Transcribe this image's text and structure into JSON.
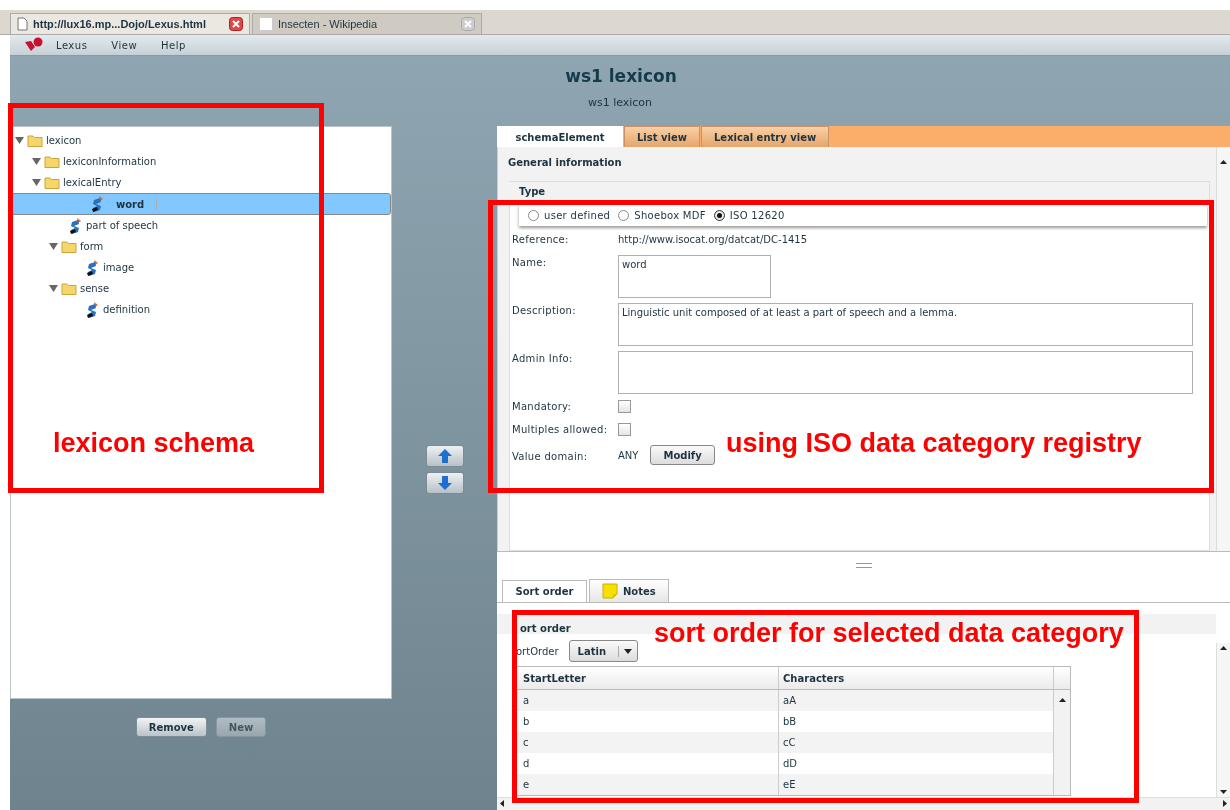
{
  "browser_tabs": [
    {
      "label": "http://lux16.mp...Dojo/Lexus.html",
      "selected": true
    },
    {
      "label": "Insecten - Wikipedia",
      "selected": false
    }
  ],
  "menu": [
    "Lexus",
    "View",
    "Help"
  ],
  "title": "ws1 lexicon",
  "subtitle": "ws1 lexicon",
  "tree": [
    {
      "label": "lexicon",
      "kind": "folder",
      "expanded": true,
      "selected": false,
      "children": [
        {
          "label": "lexiconInformation",
          "kind": "folder",
          "expanded": true,
          "selected": false
        },
        {
          "label": "lexicalEntry",
          "kind": "folder",
          "expanded": true,
          "selected": false,
          "children": [
            {
              "label": "word",
              "kind": "element",
              "selected": true
            },
            {
              "label": "part of speech",
              "kind": "element",
              "selected": false
            },
            {
              "label": "form",
              "kind": "folder",
              "expanded": true,
              "selected": false,
              "children": [
                {
                  "label": "image",
                  "kind": "element",
                  "selected": false
                }
              ]
            },
            {
              "label": "sense",
              "kind": "folder",
              "expanded": true,
              "selected": false,
              "children": [
                {
                  "label": "definition",
                  "kind": "element",
                  "selected": false
                }
              ]
            }
          ]
        }
      ]
    }
  ],
  "tree_buttons": [
    {
      "label": "Remove",
      "disabled": false
    },
    {
      "label": "New",
      "disabled": true
    }
  ],
  "tabs": [
    {
      "label": "schemaElement",
      "selected": true
    },
    {
      "label": "List view",
      "selected": false
    },
    {
      "label": "Lexical entry view",
      "selected": false
    }
  ],
  "section_title": "General information",
  "type_legend": "Type",
  "type_options": [
    {
      "label": "user defined",
      "selected": false
    },
    {
      "label": "Shoebox MDF",
      "selected": false
    },
    {
      "label": "ISO 12620",
      "selected": true
    }
  ],
  "fields": [
    {
      "kind": "text",
      "label": "Reference:",
      "value": "http://www.isocat.org/datcat/DC-1415"
    },
    {
      "kind": "small-box",
      "label": "Name:",
      "value": "word"
    },
    {
      "kind": "box",
      "label": "Description:",
      "value": "Linguistic unit composed of at least a part of speech and a lemma."
    },
    {
      "kind": "box",
      "label": "Admin Info:"
    },
    {
      "kind": "checkbox",
      "label": "Mandatory:",
      "checked": false
    },
    {
      "kind": "checkbox",
      "label": "Multiples allowed:",
      "checked": false
    },
    {
      "kind": "domain",
      "label": "Value domain:",
      "value": "ANY",
      "button": "Modify"
    }
  ],
  "lower_tabs": [
    {
      "label": "Sort order",
      "selected": true,
      "kind": "plain"
    },
    {
      "label": "Notes",
      "selected": false,
      "kind": "note"
    }
  ],
  "sort": {
    "heading": "ort order",
    "label": "ortOrder",
    "value": "Latin",
    "columns": [
      "StartLetter",
      "Characters"
    ],
    "rows": [
      [
        "a",
        "aA"
      ],
      [
        "b",
        "bB"
      ],
      [
        "c",
        "cC"
      ],
      [
        "d",
        "dD"
      ],
      [
        "e",
        "eE"
      ]
    ]
  },
  "annotations": [
    "lexicon schema",
    "using ISO data category registry",
    "sort order for selected data category"
  ]
}
